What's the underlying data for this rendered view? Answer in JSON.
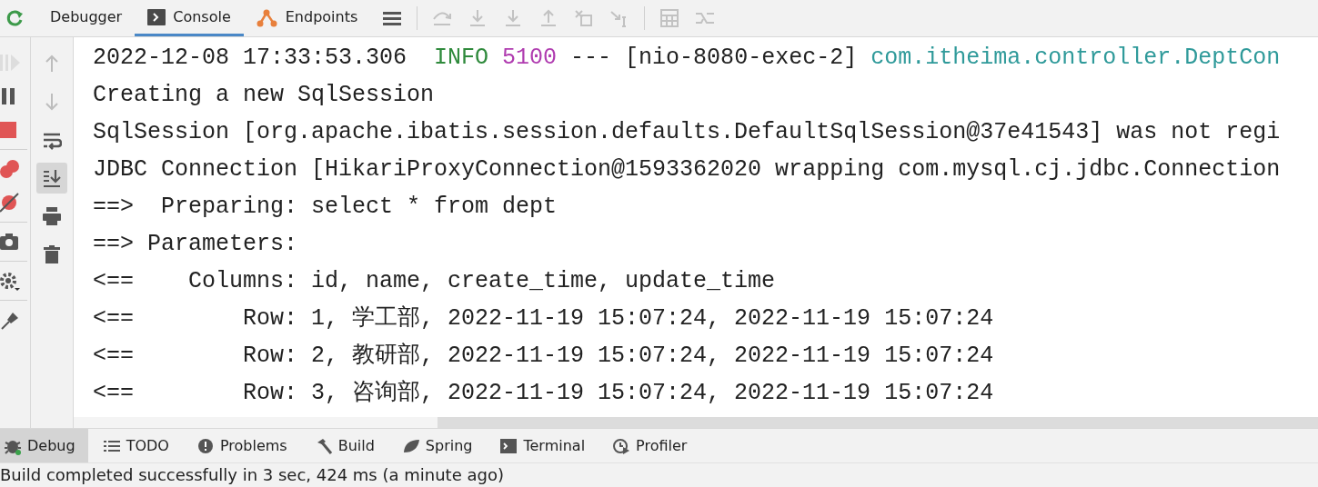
{
  "top_tabs": [
    {
      "label": "Debugger",
      "selected": false,
      "kind": "debugger"
    },
    {
      "label": "Console",
      "selected": true,
      "kind": "console"
    },
    {
      "label": "Endpoints",
      "selected": false,
      "kind": "endpoints"
    }
  ],
  "top_actions": [
    {
      "kind": "lines",
      "disabled": false
    },
    {
      "kind": "step-over",
      "disabled": true
    },
    {
      "kind": "step-into",
      "disabled": true
    },
    {
      "kind": "force-step",
      "disabled": true
    },
    {
      "kind": "step-out",
      "disabled": true
    },
    {
      "kind": "drop-frame",
      "disabled": true
    },
    {
      "kind": "run-cursor",
      "disabled": true
    },
    {
      "kind": "calculator",
      "disabled": true
    },
    {
      "kind": "streams",
      "disabled": true
    }
  ],
  "debug_tools": [
    {
      "kind": "resume",
      "disabled": true
    },
    {
      "kind": "pause",
      "disabled": false
    },
    {
      "kind": "stop",
      "disabled": false
    },
    {
      "kind": "breakpoints",
      "disabled": false
    },
    {
      "kind": "mute",
      "disabled": false
    },
    {
      "kind": "camera",
      "disabled": false
    },
    {
      "kind": "gear",
      "disabled": false
    },
    {
      "kind": "pin",
      "disabled": false
    }
  ],
  "console_tools": [
    {
      "kind": "up",
      "selected": false,
      "disabled": true
    },
    {
      "kind": "down",
      "selected": false,
      "disabled": true
    },
    {
      "kind": "wrap",
      "selected": false,
      "disabled": false
    },
    {
      "kind": "scroll-end",
      "selected": true,
      "disabled": false
    },
    {
      "kind": "print",
      "selected": false,
      "disabled": false
    },
    {
      "kind": "trash",
      "selected": false,
      "disabled": false
    }
  ],
  "console_lines": [
    [
      {
        "text": "2022-12-08 17:33:53.306  ",
        "kind": "plain"
      },
      {
        "text": "INFO",
        "kind": "info"
      },
      {
        "text": " 5100",
        "kind": "pid"
      },
      {
        "text": " --- [nio-8080-exec-2] ",
        "kind": "plain"
      },
      {
        "text": "com.itheima.controller.DeptCon",
        "kind": "logger"
      }
    ],
    [
      {
        "text": "Creating a new SqlSession",
        "kind": "plain"
      }
    ],
    [
      {
        "text": "SqlSession [org.apache.ibatis.session.defaults.DefaultSqlSession@37e41543] was not regi",
        "kind": "plain"
      }
    ],
    [
      {
        "text": "JDBC Connection [HikariProxyConnection@1593362020 wrapping com.mysql.cj.jdbc.Connection",
        "kind": "plain"
      }
    ],
    [
      {
        "text": "==>  Preparing: select * from dept",
        "kind": "plain"
      }
    ],
    [
      {
        "text": "==> Parameters:",
        "kind": "plain"
      }
    ],
    [
      {
        "text": "<==    Columns: id, name, create_time, update_time",
        "kind": "plain"
      }
    ],
    [
      {
        "text": "<==        Row: 1, 学工部, 2022-11-19 15:07:24, 2022-11-19 15:07:24",
        "kind": "plain"
      }
    ],
    [
      {
        "text": "<==        Row: 2, 教研部, 2022-11-19 15:07:24, 2022-11-19 15:07:24",
        "kind": "plain"
      }
    ],
    [
      {
        "text": "<==        Row: 3, 咨询部, 2022-11-19 15:07:24, 2022-11-19 15:07:24",
        "kind": "plain"
      }
    ]
  ],
  "tool_windows": [
    {
      "label": "Debug",
      "selected": true,
      "kind": "bug"
    },
    {
      "label": "TODO",
      "selected": false,
      "kind": "list"
    },
    {
      "label": "Problems",
      "selected": false,
      "kind": "alert"
    },
    {
      "label": "Build",
      "selected": false,
      "kind": "hammer"
    },
    {
      "label": "Spring",
      "selected": false,
      "kind": "leaf"
    },
    {
      "label": "Terminal",
      "selected": false,
      "kind": "terminal"
    },
    {
      "label": "Profiler",
      "selected": false,
      "kind": "profiler"
    }
  ],
  "status_bar": "Build completed successfully in 3 sec, 424 ms (a minute ago)"
}
